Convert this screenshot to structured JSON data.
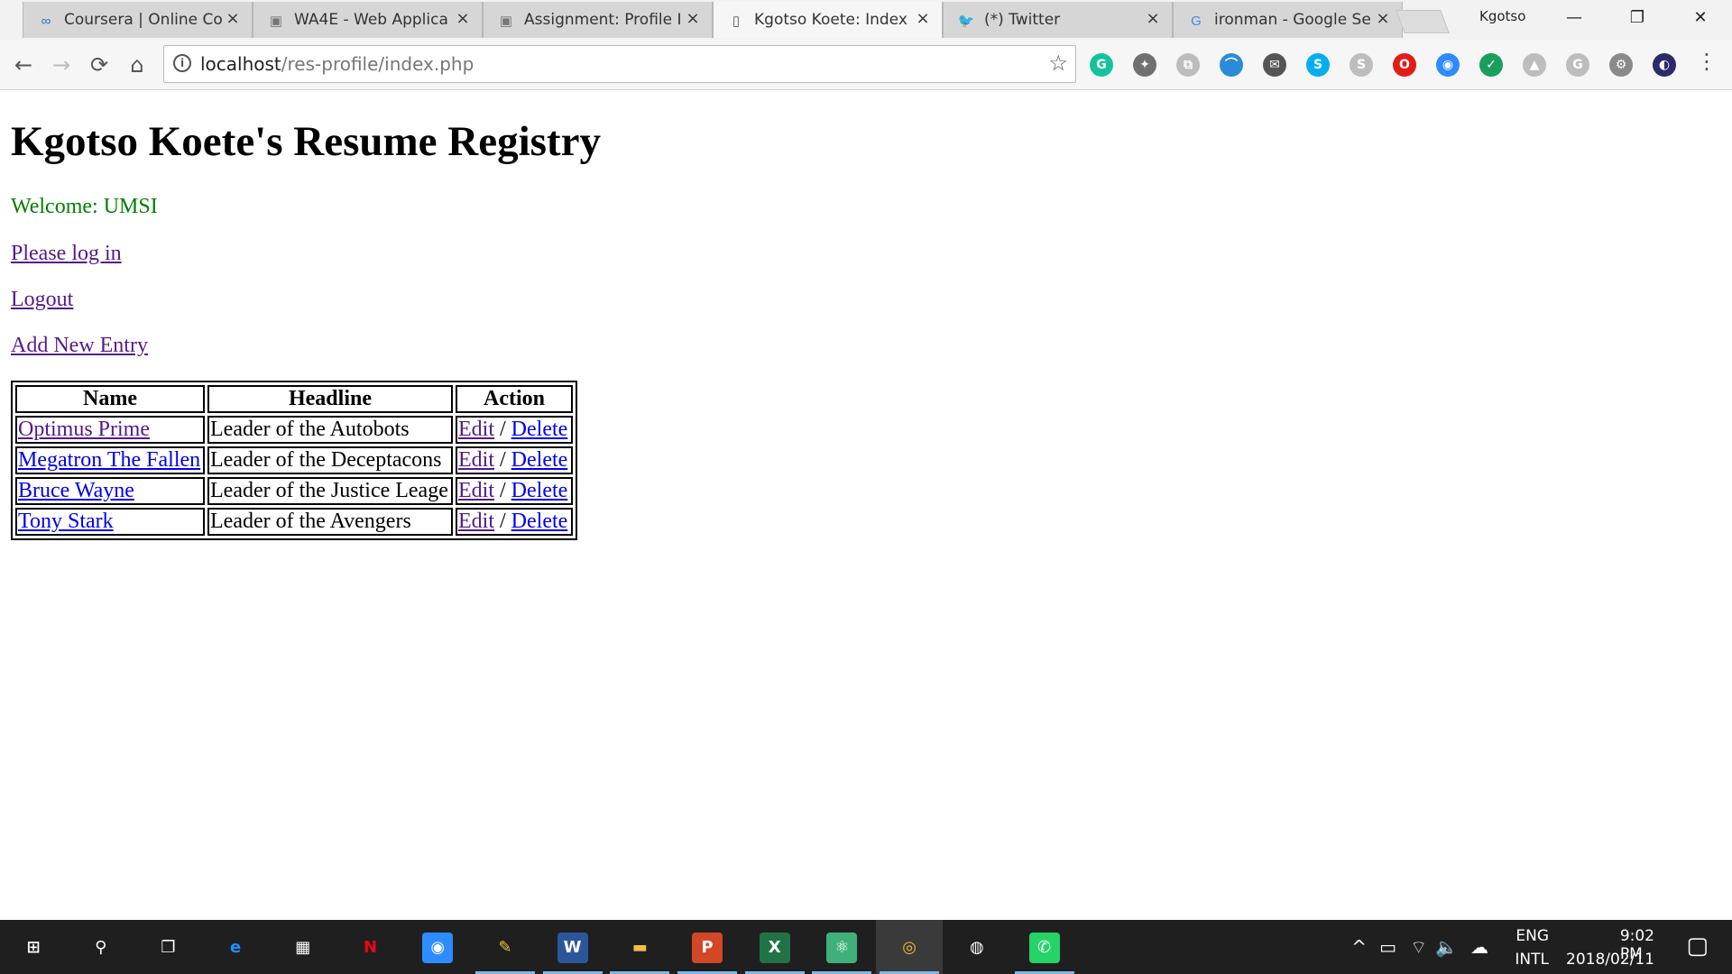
{
  "tabs": [
    {
      "title": "Coursera | Online Co",
      "icon": "coursera-icon",
      "active": false
    },
    {
      "title": "WA4E - Web Applica",
      "icon": "wa4e-icon",
      "active": false
    },
    {
      "title": "Assignment: Profile I",
      "icon": "wa4e-icon",
      "active": false
    },
    {
      "title": "Kgotso Koete: Index",
      "icon": "page-icon",
      "active": true
    },
    {
      "title": "(*) Twitter",
      "icon": "twitter-icon",
      "active": false
    },
    {
      "title": "ironman - Google Se",
      "icon": "google-icon",
      "active": false
    }
  ],
  "close_glyph": "×",
  "profile_name": "Kgotso",
  "window_controls": {
    "minimize": "—",
    "restore": "❐",
    "close": "✕"
  },
  "toolbar": {
    "back": "←",
    "forward": "→",
    "reload": "⟳",
    "home": "⌂",
    "url_host": "localhost",
    "url_path": "/res-profile/index.php",
    "info_glyph": "i",
    "star_glyph": "☆",
    "menu_glyph": "⋮"
  },
  "extensions": [
    {
      "name": "grammarly-icon",
      "glyph": "G",
      "color": "#15c39a"
    },
    {
      "name": "puzzle-icon",
      "glyph": "✦",
      "color": "#707070"
    },
    {
      "name": "pdf-icon",
      "glyph": "⧉",
      "color": "#bdbdbd"
    },
    {
      "name": "rainbow-icon",
      "glyph": "⌒",
      "color": "#2a8cd8"
    },
    {
      "name": "mail-icon",
      "glyph": "✉",
      "color": "#555555"
    },
    {
      "name": "skype-icon",
      "glyph": "S",
      "color": "#00aff0"
    },
    {
      "name": "skype-grey-icon",
      "glyph": "S",
      "color": "#bdbdbd"
    },
    {
      "name": "opera-icon",
      "glyph": "O",
      "color": "#e41b17"
    },
    {
      "name": "zoom-icon",
      "glyph": "◉",
      "color": "#2d8cff"
    },
    {
      "name": "shield-icon",
      "glyph": "✓",
      "color": "#1a9e5c"
    },
    {
      "name": "drive-icon",
      "glyph": "▲",
      "color": "#bdbdbd"
    },
    {
      "name": "g-icon",
      "glyph": "G",
      "color": "#bdbdbd"
    },
    {
      "name": "gear-icon",
      "glyph": "⚙",
      "color": "#8a8a8a"
    },
    {
      "name": "firefox-icon",
      "glyph": "◐",
      "color": "#2b2b6b"
    }
  ],
  "page": {
    "heading": "Kgotso Koete's Resume Registry",
    "welcome": "Welcome: UMSI",
    "login_link": "Please log in",
    "logout_link": "Logout",
    "add_link": "Add New Entry",
    "table": {
      "headers": [
        "Name",
        "Headline",
        "Action"
      ],
      "rows": [
        {
          "name": "Optimus Prime",
          "headline": "Leader of the Autobots",
          "edit": "Edit",
          "sep": "/",
          "delete": "Delete"
        },
        {
          "name": "Megatron The Fallen",
          "headline": "Leader of the Deceptacons",
          "edit": "Edit",
          "sep": "/",
          "delete": "Delete"
        },
        {
          "name": "Bruce Wayne",
          "headline": "Leader of the Justice Leage",
          "edit": "Edit",
          "sep": "/",
          "delete": "Delete"
        },
        {
          "name": "Tony Stark",
          "headline": "Leader of the Avengers",
          "edit": "Edit",
          "sep": "/",
          "delete": "Delete"
        }
      ]
    }
  },
  "taskbar": {
    "apps": [
      {
        "name": "start-icon",
        "glyph": "⊞",
        "bg": "",
        "fg": "#ffffff",
        "running": false,
        "active": false
      },
      {
        "name": "search-icon",
        "glyph": "⚲",
        "bg": "",
        "fg": "#ffffff",
        "running": false,
        "active": false
      },
      {
        "name": "task-view-icon",
        "glyph": "❐",
        "bg": "",
        "fg": "#ffffff",
        "running": false,
        "active": false
      },
      {
        "name": "edge-icon",
        "glyph": "e",
        "bg": "",
        "fg": "#1e90ff",
        "running": false,
        "active": false
      },
      {
        "name": "store-icon",
        "glyph": "▦",
        "bg": "",
        "fg": "#ffffff",
        "running": false,
        "active": false
      },
      {
        "name": "netflix-icon",
        "glyph": "N",
        "bg": "",
        "fg": "#e50914",
        "running": false,
        "active": false
      },
      {
        "name": "zoom-app-icon",
        "glyph": "◉",
        "bg": "#2d8cff",
        "fg": "#ffffff",
        "running": false,
        "active": false
      },
      {
        "name": "paint-icon",
        "glyph": "✎",
        "bg": "",
        "fg": "#f0c040",
        "running": true,
        "active": false
      },
      {
        "name": "word-icon",
        "glyph": "W",
        "bg": "#2b579a",
        "fg": "#ffffff",
        "running": true,
        "active": false
      },
      {
        "name": "file-explorer-icon",
        "glyph": "▬",
        "bg": "",
        "fg": "#f0c040",
        "running": true,
        "active": false
      },
      {
        "name": "powerpoint-icon",
        "glyph": "P",
        "bg": "#d24726",
        "fg": "#ffffff",
        "running": true,
        "active": false
      },
      {
        "name": "excel-icon",
        "glyph": "X",
        "bg": "#217346",
        "fg": "#ffffff",
        "running": true,
        "active": false
      },
      {
        "name": "atom-icon",
        "glyph": "⚛",
        "bg": "#40b07a",
        "fg": "#ffffff",
        "running": true,
        "active": false
      },
      {
        "name": "chrome-icon",
        "glyph": "◎",
        "bg": "",
        "fg": "#e8c030",
        "running": true,
        "active": true
      },
      {
        "name": "bitnami-icon",
        "glyph": "◍",
        "bg": "",
        "fg": "#ffffff",
        "running": false,
        "active": false
      },
      {
        "name": "whatsapp-icon",
        "glyph": "✆",
        "bg": "#25d366",
        "fg": "#ffffff",
        "running": true,
        "active": false
      }
    ],
    "tray": {
      "chevron": "^",
      "battery": "▭",
      "wifi": "⌔",
      "volume": "🔈",
      "onedrive": "☁",
      "lang_top": "ENG",
      "lang_bottom": "INTL",
      "time": "9:02 PM",
      "date": "2018/02/11",
      "notifications": "▢"
    }
  }
}
